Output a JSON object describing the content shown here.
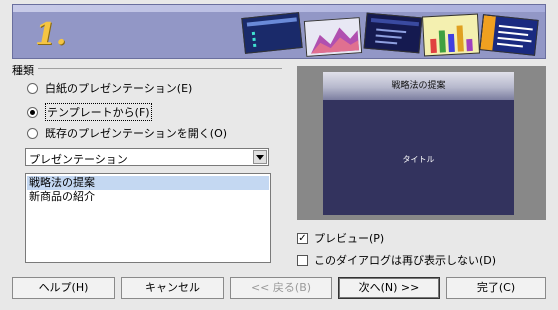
{
  "banner": {
    "step_number": "1."
  },
  "type_group": {
    "label": "種類",
    "options": [
      {
        "label": "白紙のプレゼンテーション(E)",
        "checked": false
      },
      {
        "label": "テンプレートから(F)",
        "checked": true
      },
      {
        "label": "既存のプレゼンテーションを開く(O)",
        "checked": false
      }
    ]
  },
  "category_select": {
    "value": "プレゼンテーション"
  },
  "template_list": {
    "items": [
      {
        "label": "戦略法の提案",
        "selected": true
      },
      {
        "label": "新商品の紹介",
        "selected": false
      }
    ]
  },
  "preview": {
    "title": "戦略法の提案",
    "body": "タイトル"
  },
  "options": {
    "preview": {
      "label": "プレビュー(P)",
      "checked": true
    },
    "dont_show": {
      "label": "このダイアログは再び表示しない(D)",
      "checked": false
    }
  },
  "buttons": {
    "help": "ヘルプ(H)",
    "cancel": "キャンセル",
    "back": "<< 戻る(B)",
    "next": "次へ(N) >>",
    "finish": "完了(C)"
  },
  "colors": {
    "banner": "#9297c6",
    "slide": "#33335e",
    "selection": "#c4d8f2"
  }
}
